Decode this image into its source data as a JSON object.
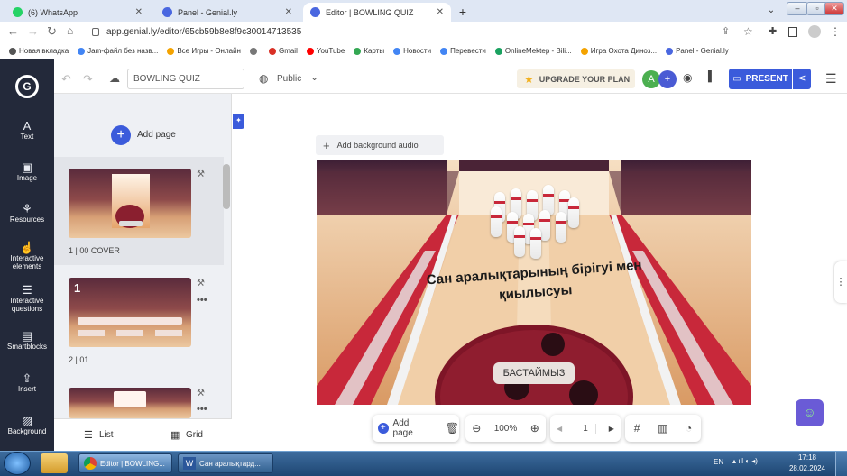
{
  "browser": {
    "tabs": [
      {
        "title": "(6) WhatsApp",
        "color": "#25d366"
      },
      {
        "title": "Panel - Genial.ly",
        "color": "#4a67e0"
      },
      {
        "title": "Editor | BOWLING QUIZ",
        "color": "#4a67e0"
      }
    ],
    "new_tab": "+",
    "url": "app.genial.ly/editor/65cb59b8e8f9c30014713535",
    "bookmarks": [
      {
        "label": "Новая вкладка",
        "color": "#555"
      },
      {
        "label": "Jam-файл без назв...",
        "color": "#4285f4"
      },
      {
        "label": "Все Игры - Онлайн",
        "color": "#f4a300"
      },
      {
        "label": "",
        "color": "#777"
      },
      {
        "label": "Gmail",
        "color": "#d93025"
      },
      {
        "label": "YouTube",
        "color": "#ff0000"
      },
      {
        "label": "Карты",
        "color": "#34a853"
      },
      {
        "label": "Новости",
        "color": "#4285f4"
      },
      {
        "label": "Перевести",
        "color": "#4285f4"
      },
      {
        "label": "OnlineMektep - Bili...",
        "color": "#1aa260"
      },
      {
        "label": "Игра Охота Диноз...",
        "color": "#f4a300"
      },
      {
        "label": "Panel - Genial.ly",
        "color": "#4a67e0"
      }
    ]
  },
  "editor": {
    "project_name": "BOWLING QUIZ",
    "visibility": "Public",
    "upgrade_label": "UPGRADE YOUR PLAN",
    "avatar_letter": "A",
    "present_label": "PRESENT",
    "add_page_label": "Add page",
    "add_audio_label": "Add background audio",
    "list_label": "List",
    "grid_label": "Grid"
  },
  "sidebar": {
    "items": [
      {
        "label": "Text",
        "icon": "A"
      },
      {
        "label": "Image",
        "icon": "▣"
      },
      {
        "label": "Resources",
        "icon": "⚘"
      },
      {
        "label": "Interactive elements",
        "icon": "☝"
      },
      {
        "label": "Interactive questions",
        "icon": "☰"
      },
      {
        "label": "Smartblocks",
        "icon": "▤"
      },
      {
        "label": "Insert",
        "icon": "⇪"
      },
      {
        "label": "Background",
        "icon": "▨"
      }
    ]
  },
  "pages": [
    {
      "label": "1 |  00 COVER"
    },
    {
      "label": "2 |  01"
    },
    {
      "label": ""
    }
  ],
  "slide": {
    "title": "Сан аралықтарының бірігуі мен қиылысуы",
    "start_button": "БАСТАЙМЫЗ"
  },
  "bottom_toolbar": {
    "add_page": "Add page",
    "zoom": "100%",
    "page_number": "1"
  },
  "taskbar": {
    "windows": [
      {
        "title": "Editor | BOWLING..."
      },
      {
        "title": "Сан аралықтард..."
      }
    ],
    "lang": "EN",
    "time": "17:18",
    "date": "28.02.2024"
  }
}
